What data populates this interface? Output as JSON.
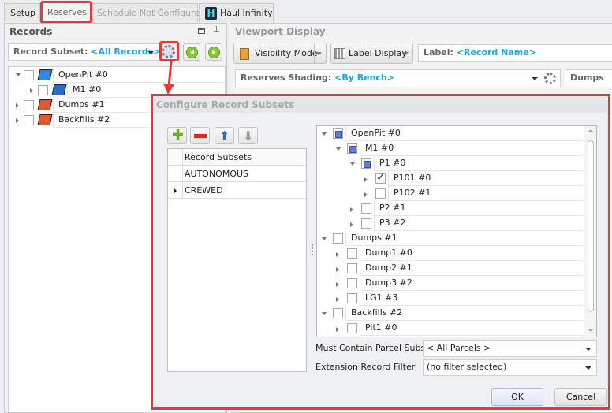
{
  "tabs": [
    {
      "label": "Setup"
    },
    {
      "label": "Reserves"
    },
    {
      "label": "Schedule Not Configured"
    },
    {
      "label": "Haul Infinity"
    }
  ],
  "records": {
    "title": "Records",
    "subset_label": "Record Subset:",
    "subset_value": "<All Records>",
    "tree": [
      {
        "label": "OpenPit #0",
        "level": 0,
        "exp": "o"
      },
      {
        "label": "M1 #0",
        "level": 1,
        "exp": "c"
      },
      {
        "label": "Dumps #1",
        "level": 0,
        "exp": "c"
      },
      {
        "label": "Backfills #2",
        "level": 0,
        "exp": "c"
      }
    ]
  },
  "viewport": {
    "title": "Viewport Display",
    "visibility_mode": "Visibility Mode",
    "label_display": "Label Display",
    "label_field": "Label:",
    "label_value": "<Record Name>",
    "shading_label": "Reserves Shading:",
    "shading_value": "<By Bench>",
    "dumps": "Dumps"
  },
  "dialog": {
    "title": "Configure Record Subsets",
    "grid_header": "Record Subsets",
    "subsets": [
      "AUTONOMOUS",
      "CREWED"
    ],
    "selected_subset": "CREWED",
    "tree": [
      {
        "label": "OpenPit #0",
        "level": 0,
        "exp": "o",
        "state": "part"
      },
      {
        "label": "M1 #0",
        "level": 1,
        "exp": "o",
        "state": "part"
      },
      {
        "label": "P1 #0",
        "level": 2,
        "exp": "o",
        "state": "part"
      },
      {
        "label": "P101 #0",
        "level": 3,
        "exp": "c",
        "state": "chk"
      },
      {
        "label": "P102 #1",
        "level": 3,
        "exp": "c",
        "state": ""
      },
      {
        "label": "P2 #1",
        "level": 2,
        "exp": "c",
        "state": ""
      },
      {
        "label": "P3 #2",
        "level": 2,
        "exp": "c",
        "state": ""
      },
      {
        "label": "Dumps #1",
        "level": 0,
        "exp": "o",
        "state": ""
      },
      {
        "label": "Dump1 #0",
        "level": 1,
        "exp": "c",
        "state": ""
      },
      {
        "label": "Dump2 #1",
        "level": 1,
        "exp": "c",
        "state": ""
      },
      {
        "label": "Dump3 #2",
        "level": 1,
        "exp": "c",
        "state": ""
      },
      {
        "label": "LG1 #3",
        "level": 1,
        "exp": "c",
        "state": ""
      },
      {
        "label": "Backfills #2",
        "level": 0,
        "exp": "o",
        "state": ""
      },
      {
        "label": "Pit1 #0",
        "level": 1,
        "exp": "c",
        "state": ""
      }
    ],
    "parcel_label": "Must Contain Parcel Subset",
    "parcel_value": "< All Parcels >",
    "filter_label": "Extension Record Filter",
    "filter_value": "(no filter selected)",
    "ok": "OK",
    "cancel": "Cancel"
  },
  "colors": {
    "highlight": "#e33a3a",
    "accent": "#18a8e8"
  }
}
